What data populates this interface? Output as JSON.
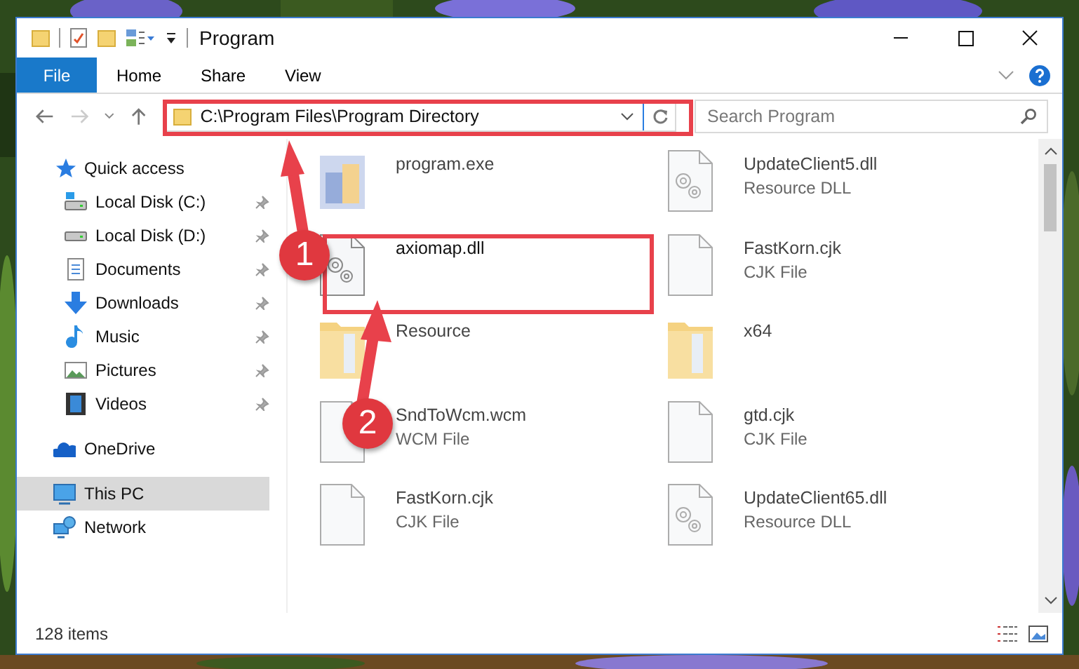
{
  "window": {
    "title": "Program"
  },
  "ribbon": {
    "tabs": [
      {
        "label": "File",
        "kind": "file"
      },
      {
        "label": "Home",
        "kind": "tab"
      },
      {
        "label": "Share",
        "kind": "tab"
      },
      {
        "label": "View",
        "kind": "tab"
      }
    ]
  },
  "address_bar": {
    "path": "C:\\Program Files\\Program Directory"
  },
  "search": {
    "placeholder": "Search Program"
  },
  "sidebar": {
    "items": [
      {
        "label": "Quick access",
        "kind": "star",
        "selected": false,
        "children": [
          {
            "label": "Local Disk (C:)",
            "kind": "drive-c",
            "pinned": true,
            "selected": false
          },
          {
            "label": "Local Disk (D:)",
            "kind": "drive",
            "pinned": true,
            "selected": false
          },
          {
            "label": "Documents",
            "kind": "documents",
            "pinned": true,
            "selected": false
          },
          {
            "label": "Downloads",
            "kind": "downloads",
            "pinned": true,
            "selected": false
          },
          {
            "label": "Music",
            "kind": "music",
            "pinned": true,
            "selected": false
          },
          {
            "label": "Pictures",
            "kind": "pictures",
            "pinned": true,
            "selected": false
          },
          {
            "label": "Videos",
            "kind": "videos",
            "pinned": true,
            "selected": false
          }
        ]
      },
      {
        "label": "OneDrive",
        "kind": "cloud",
        "selected": false
      },
      {
        "label": "This PC",
        "kind": "pc",
        "selected": true
      },
      {
        "label": "Network",
        "kind": "network",
        "selected": false
      }
    ]
  },
  "files": [
    {
      "name": "program.exe",
      "kind": "app",
      "blurred": true
    },
    {
      "name": "UpdateClient5.dll",
      "type": "Resource DLL",
      "kind": "dll",
      "blurred": true
    },
    {
      "name": "axiomap.dll",
      "kind": "dll",
      "blurred": false
    },
    {
      "name": "FastKorn.cjk",
      "type": "CJK File",
      "kind": "doc",
      "blurred": true
    },
    {
      "name": "Resource",
      "kind": "folder",
      "blurred": true
    },
    {
      "name": "x64",
      "kind": "folder",
      "blurred": true
    },
    {
      "name": "SndToWcm.wcm",
      "type": "WCM File",
      "kind": "doc",
      "blurred": true
    },
    {
      "name": "gtd.cjk",
      "type": "CJK File",
      "kind": "doc",
      "blurred": true
    },
    {
      "name": "FastKorn.cjk",
      "type": "CJK File",
      "kind": "doc",
      "blurred": true
    },
    {
      "name": "UpdateClient65.dll",
      "type": "Resource DLL",
      "kind": "dll",
      "blurred": true
    }
  ],
  "status_bar": {
    "count": "128 items"
  },
  "annotations": [
    {
      "number": "1"
    },
    {
      "number": "2"
    }
  ]
}
